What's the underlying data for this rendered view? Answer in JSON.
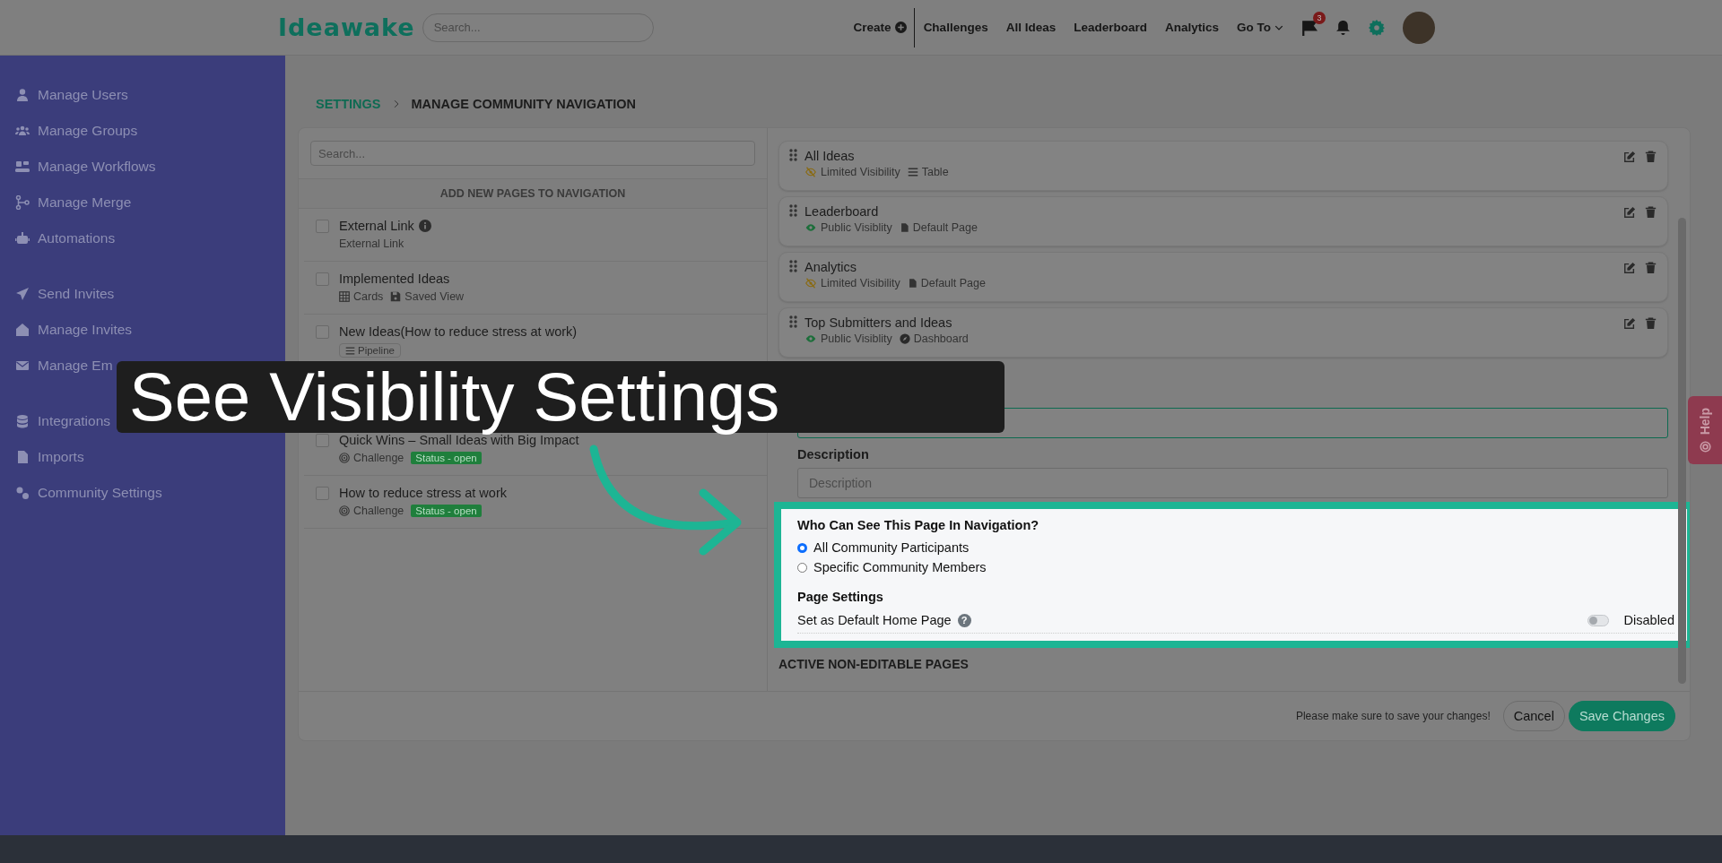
{
  "topbar": {
    "logo": "Ideawake",
    "search": {
      "placeholder": "Search..."
    },
    "nav": [
      {
        "label": "Create",
        "kind": "create"
      },
      {
        "label": "Challenges",
        "kind": "link"
      },
      {
        "label": "All Ideas",
        "kind": "link"
      },
      {
        "label": "Leaderboard",
        "kind": "link"
      },
      {
        "label": "Analytics",
        "kind": "link"
      },
      {
        "label": "Go To",
        "kind": "dropdown"
      }
    ],
    "flag_badge": "3"
  },
  "sidebar": {
    "groups": [
      {
        "items": [
          {
            "label": "Manage Users"
          },
          {
            "label": "Manage Groups"
          },
          {
            "label": "Manage Workflows"
          },
          {
            "label": "Manage Merge"
          },
          {
            "label": "Automations"
          }
        ]
      },
      {
        "items": [
          {
            "label": "Send Invites"
          },
          {
            "label": "Manage Invites"
          },
          {
            "label": "Manage Em"
          }
        ]
      },
      {
        "items": [
          {
            "label": "Integrations"
          },
          {
            "label": "Imports"
          },
          {
            "label": "Community Settings"
          }
        ]
      }
    ]
  },
  "breadcrumb": {
    "parent": "SETTINGS",
    "current": "MANAGE COMMUNITY NAVIGATION"
  },
  "available_pages": {
    "search": {
      "placeholder": "Search..."
    },
    "heading": "ADD NEW PAGES TO NAVIGATION",
    "items": [
      {
        "title": "External Link",
        "checked": false,
        "info": true,
        "meta": [
          {
            "kind": "text",
            "label": "External Link"
          }
        ]
      },
      {
        "title": "Implemented Ideas",
        "checked": false,
        "meta": [
          {
            "kind": "cards",
            "label": "Cards"
          },
          {
            "kind": "saved",
            "label": "Saved View"
          }
        ]
      },
      {
        "title": "New Ideas(How to reduce stress at work)",
        "checked": false,
        "meta": [
          {
            "kind": "pipeline",
            "label": "Pipeline"
          }
        ]
      },
      {
        "title": "Quick Wins – Small Ideas with Big Impact",
        "checked": false,
        "meta": [
          {
            "kind": "challenge",
            "label": "Challenge"
          },
          {
            "kind": "status",
            "label": "Status - open"
          }
        ]
      },
      {
        "title": "How to reduce stress at work",
        "checked": false,
        "meta": [
          {
            "kind": "challenge",
            "label": "Challenge"
          },
          {
            "kind": "status",
            "label": "Status - open"
          }
        ]
      }
    ]
  },
  "navigation_pages": [
    {
      "title": "All Ideas",
      "visibility": {
        "kind": "limited",
        "label": "Limited Visibility"
      },
      "type": {
        "kind": "table",
        "label": "Table"
      }
    },
    {
      "title": "Leaderboard",
      "visibility": {
        "kind": "public",
        "label": "Public Visiblity"
      },
      "type": {
        "kind": "page",
        "label": "Default Page"
      }
    },
    {
      "title": "Analytics",
      "visibility": {
        "kind": "limited",
        "label": "Limited Visibility"
      },
      "type": {
        "kind": "page",
        "label": "Default Page"
      }
    },
    {
      "title": "Top Submitters and Ideas",
      "visibility": {
        "kind": "public",
        "label": "Public Visiblity"
      },
      "type": {
        "kind": "dashboard",
        "label": "Dashboard"
      }
    }
  ],
  "edit_form": {
    "label_field": {
      "focused": true
    },
    "description": {
      "label": "Description",
      "placeholder": "Description"
    },
    "visibility": {
      "question": "Who Can See This Page In Navigation?",
      "options": [
        {
          "label": "All Community Participants",
          "selected": true
        },
        {
          "label": "Specific Community Members",
          "selected": false
        }
      ]
    },
    "page_settings": {
      "heading": "Page Settings",
      "default_home": {
        "label": "Set as Default Home Page",
        "help_mark": "?",
        "on": false,
        "state_label": "Disabled"
      }
    }
  },
  "active_non_editable_heading": "ACTIVE NON-EDITABLE PAGES",
  "footer": {
    "note": "Please make sure to save your changes!",
    "cancel": "Cancel",
    "save": "Save Changes"
  },
  "help_tab": "Help",
  "tour": {
    "caption": "See Visibility Settings"
  }
}
